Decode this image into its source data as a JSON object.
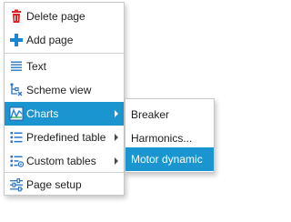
{
  "context_menu": {
    "items": [
      {
        "label": "Delete page",
        "icon": "trash-icon"
      },
      {
        "label": "Add page",
        "icon": "plus-icon"
      },
      {
        "label": "Text",
        "icon": "text-lines-icon"
      },
      {
        "label": "Scheme view",
        "icon": "scheme-icon"
      },
      {
        "label": "Charts",
        "icon": "chart-icon",
        "has_submenu": true,
        "selected": true
      },
      {
        "label": "Predefined table",
        "icon": "list-icon",
        "has_submenu": true
      },
      {
        "label": "Custom tables",
        "icon": "custom-table-icon",
        "has_submenu": true
      },
      {
        "label": "Page setup",
        "icon": "sliders-icon"
      }
    ]
  },
  "charts_submenu": {
    "items": [
      {
        "label": "Breaker"
      },
      {
        "label": "Harmonics..."
      },
      {
        "label": "Motor dynamic",
        "selected": true
      }
    ]
  },
  "colors": {
    "selection": "#1a95d0",
    "trash": "#e02121",
    "plus": "#1d86d2",
    "icon_blue": "#2c74c4"
  }
}
